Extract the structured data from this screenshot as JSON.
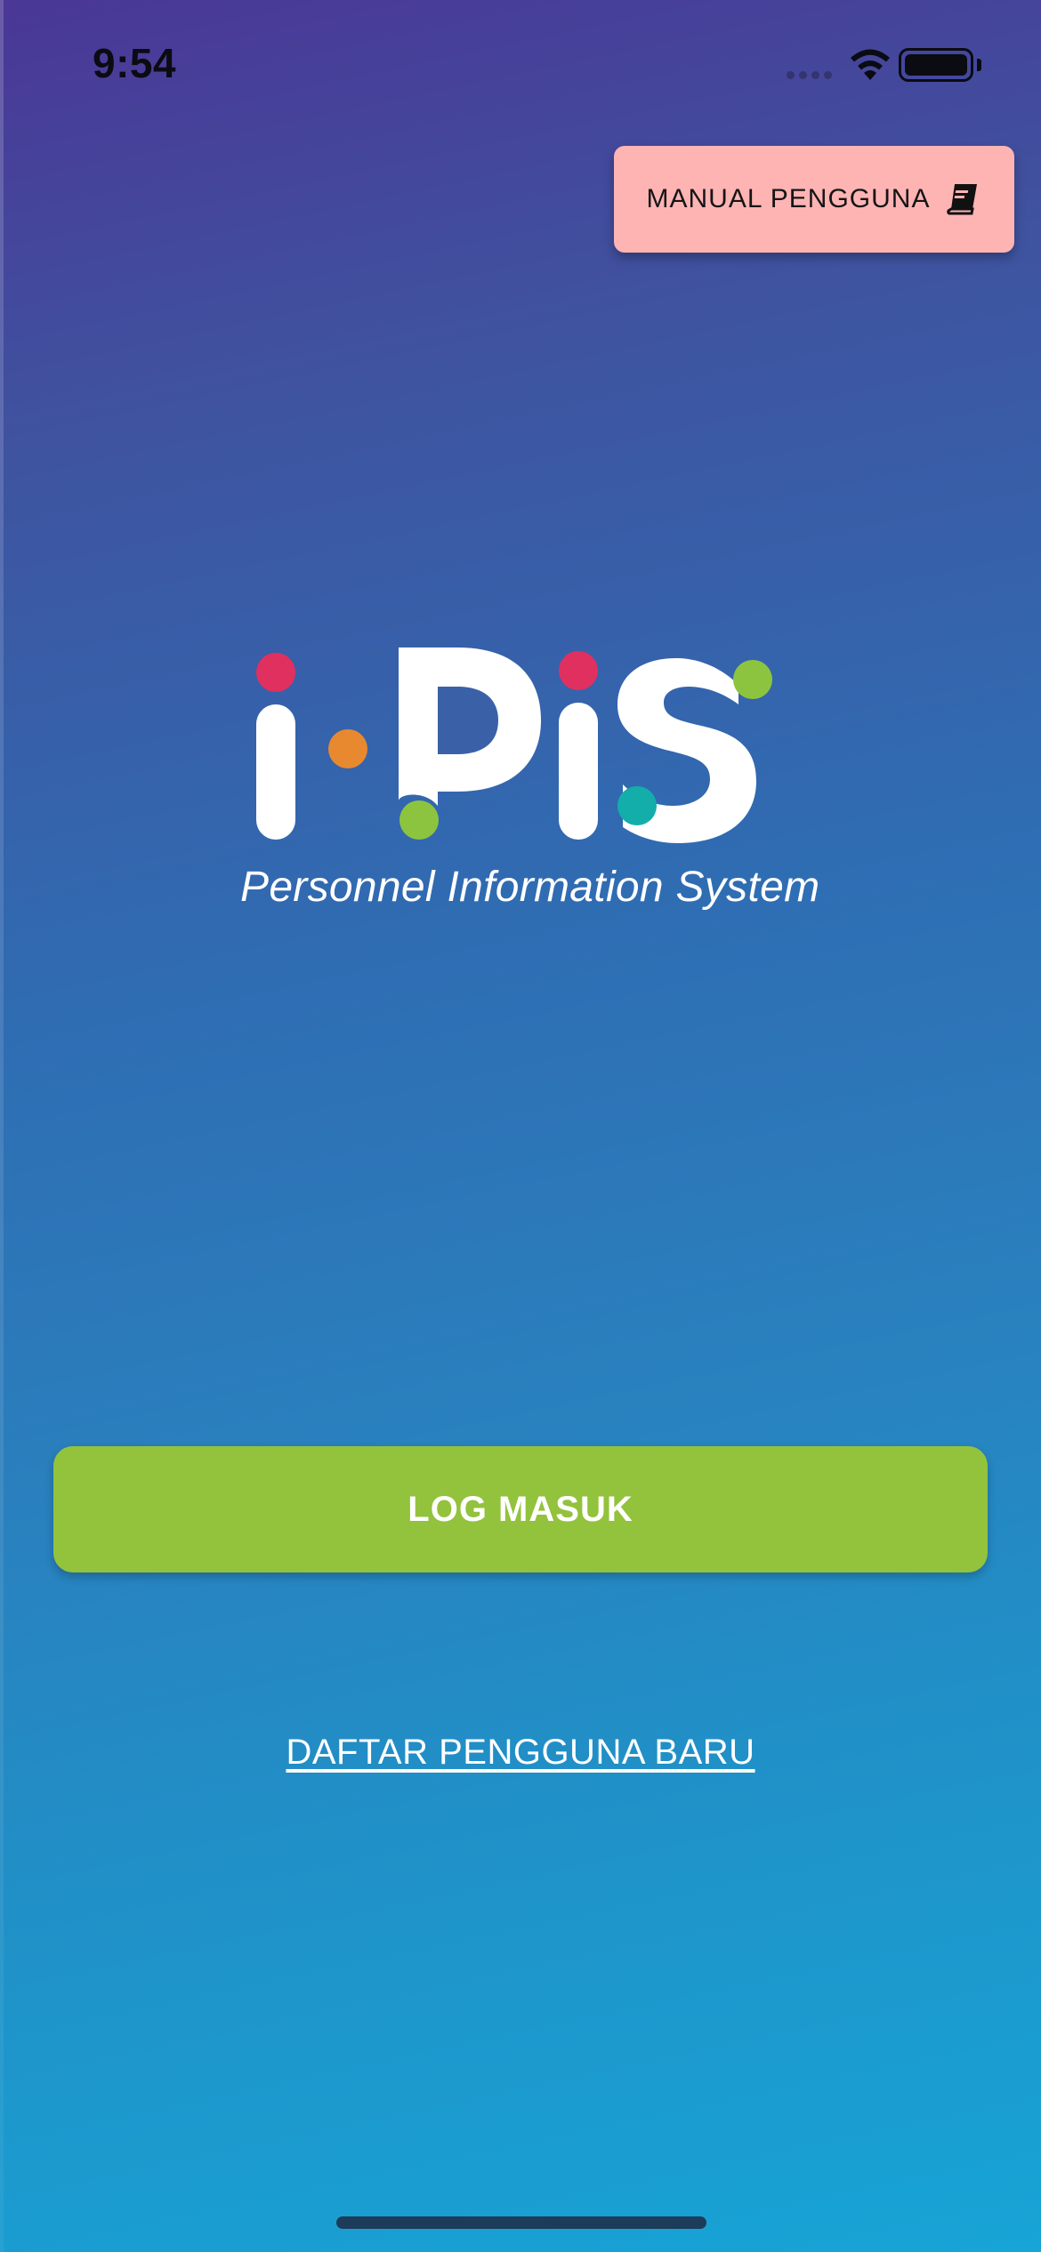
{
  "status_bar": {
    "time": "9:54"
  },
  "header": {
    "manual_button_label": "MANUAL PENGGUNA",
    "manual_button_icon": "book-icon"
  },
  "logo": {
    "wordmark": "i-PiS",
    "tagline": "Personnel Information System",
    "dot_colors": [
      "#e0305f",
      "#e8892f",
      "#8dc43f",
      "#13aeaa"
    ]
  },
  "actions": {
    "login_label": "LOG MASUK",
    "register_label": "DAFTAR PENGGUNA BARU"
  },
  "colors": {
    "login_button": "#93c23d",
    "manual_button": "#ffb4b4",
    "background_top": "#4a3796",
    "background_bottom": "#17a4d6"
  }
}
